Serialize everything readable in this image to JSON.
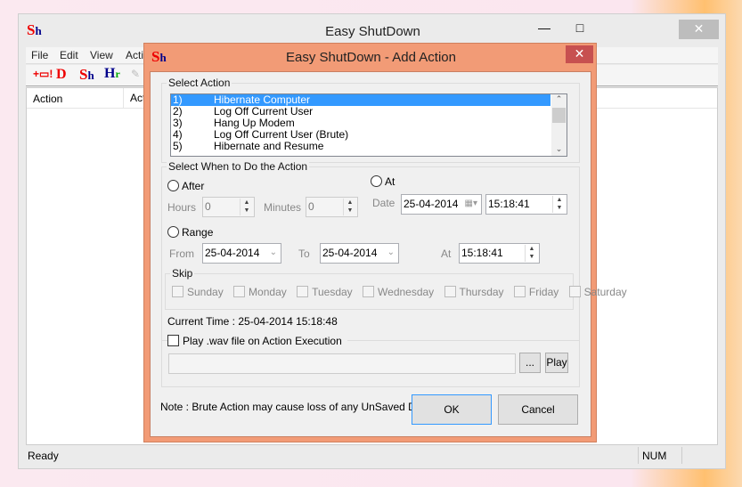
{
  "main": {
    "title": "Easy ShutDown",
    "logo": "Sh",
    "menu": [
      "File",
      "Edit",
      "View",
      "Acti"
    ],
    "toolbar": [
      {
        "icon": "add-action-icon"
      },
      {
        "label": "D",
        "icon": "delete-icon"
      },
      {
        "label": "Sh",
        "icon": "shutdown-icon"
      },
      {
        "label": "Hr",
        "icon": "hr-icon"
      },
      {
        "icon": "edit-icon"
      }
    ],
    "columns": [
      "Action",
      "Act"
    ],
    "status": {
      "text": "Ready",
      "num": "NUM"
    }
  },
  "dialog": {
    "title": "Easy ShutDown - Add Action",
    "logo": "Sh",
    "select_action": {
      "label": "Select Action",
      "items": [
        {
          "num": "1)",
          "name": "Hibernate Computer",
          "selected": true
        },
        {
          "num": "2)",
          "name": "Log Off Current User"
        },
        {
          "num": "3)",
          "name": "Hang Up Modem"
        },
        {
          "num": "4)",
          "name": "Log Off Current User (Brute)"
        },
        {
          "num": "5)",
          "name": "Hibernate and Resume"
        }
      ]
    },
    "when": {
      "label": "Select When to Do the Action",
      "after": {
        "label": "After",
        "hours_label": "Hours",
        "hours": "0",
        "minutes_label": "Minutes",
        "minutes": "0"
      },
      "at": {
        "label": "At",
        "date_label": "Date",
        "date": "25-04-2014",
        "time": "15:18:41"
      },
      "range": {
        "label": "Range",
        "from_label": "From",
        "from": "25-04-2014",
        "to_label": "To",
        "to": "25-04-2014",
        "at_label": "At",
        "time": "15:18:41"
      },
      "skip": {
        "label": "Skip",
        "days": [
          "Sunday",
          "Monday",
          "Tuesday",
          "Wednesday",
          "Thursday",
          "Friday",
          "Saturday"
        ]
      },
      "current_time": "Current Time : 25-04-2014 15:18:48"
    },
    "wav": {
      "label": "Play .wav file on Action Execution",
      "path": "",
      "browse": "...",
      "play": "Play"
    },
    "note": "Note : Brute Action may cause loss of any UnSaved Data.",
    "ok": "OK",
    "cancel": "Cancel"
  },
  "colors": {
    "dialog_frame": "#f29b76",
    "close": "#c75050",
    "selection": "#3399ff"
  }
}
